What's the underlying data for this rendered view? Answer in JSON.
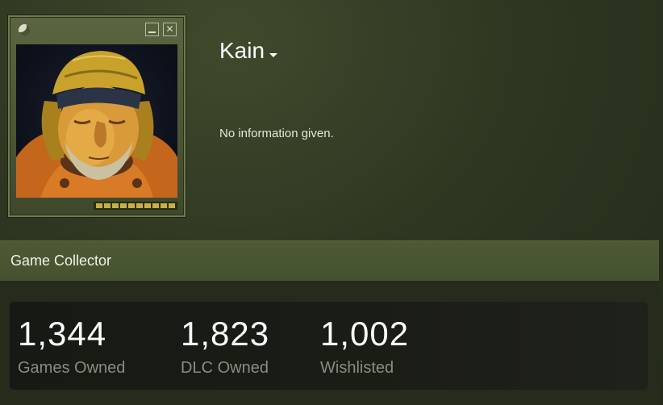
{
  "profile": {
    "name": "Kain",
    "summary": "No information given."
  },
  "avatar": {
    "frame_icon": "steam-circle-icon",
    "minimize_icon": "minimize-icon",
    "close_icon": "close-icon",
    "close_glyph": "✕"
  },
  "showcase": {
    "title": "Game Collector",
    "stats": [
      {
        "value": "1,344",
        "label": "Games Owned"
      },
      {
        "value": "1,823",
        "label": "DLC Owned"
      },
      {
        "value": "1,002",
        "label": "Wishlisted"
      }
    ]
  },
  "colors": {
    "background": "#2f3722",
    "accent_yellow": "#c8b042",
    "stat_label": "#8a8c82",
    "showcase_header": "#4d5a34"
  }
}
